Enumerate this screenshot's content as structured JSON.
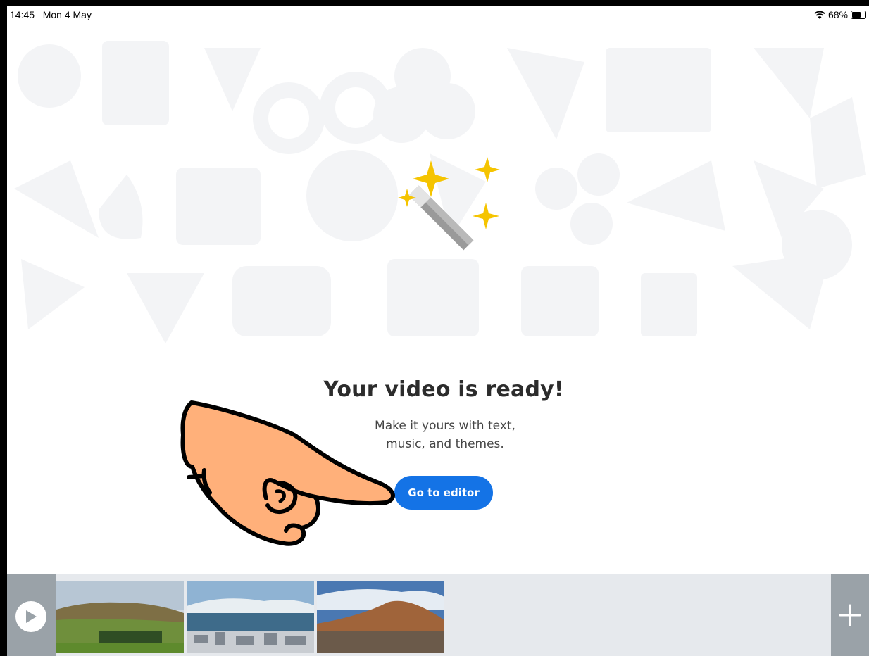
{
  "status_bar": {
    "time": "14:45",
    "date": "Mon 4 May",
    "battery": "68%",
    "icons": [
      "wifi-icon",
      "battery-icon"
    ]
  },
  "main": {
    "title": "Your video is ready!",
    "subtitle_line1": "Make it yours with text,",
    "subtitle_line2": "music, and themes.",
    "button_label": "Go to editor",
    "hero_icon": "magic-wand-icon",
    "overlay_icon": "pointing-hand-icon"
  },
  "timeline": {
    "play_icon": "play-icon",
    "add_icon": "plus-icon",
    "clips": [
      {
        "description_icon": "clip-thumbnail",
        "scene": "green cliff landscape"
      },
      {
        "description_icon": "clip-thumbnail",
        "scene": "harbor city with mountains"
      },
      {
        "description_icon": "clip-thumbnail",
        "scene": "volcanic hill"
      }
    ]
  },
  "colors": {
    "accent": "#1473e6",
    "sparkle": "#f5c400",
    "timeline_bg": "#e6e9ed",
    "side_panel": "#9aa2a8",
    "hand_skin": "#ffb07a"
  }
}
